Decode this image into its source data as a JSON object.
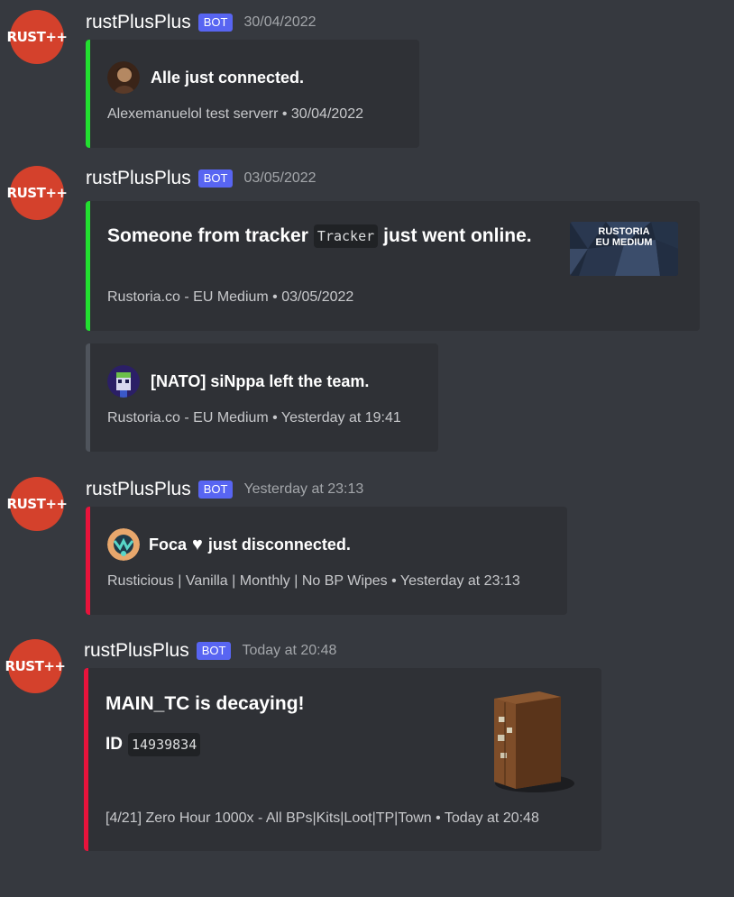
{
  "messages": [
    {
      "avatar_label": "RUST++",
      "username": "rustPlusPlus",
      "bot_tag": "BOT",
      "timestamp": "30/04/2022",
      "embed": {
        "author": "Alle just connected.",
        "footer": "Alexemanuelol test serverr • 30/04/2022",
        "color": "#22e030"
      }
    },
    {
      "avatar_label": "RUST++",
      "username": "rustPlusPlus",
      "bot_tag": "BOT",
      "timestamp": "03/05/2022",
      "embed": {
        "title_prefix": "Someone from tracker",
        "title_code": "Tracker",
        "title_suffix": "just went online.",
        "thumbnail_text_1": "RUSTORIA",
        "thumbnail_text_2": "EU MEDIUM",
        "footer": "Rustoria.co - EU Medium • 03/05/2022",
        "color": "#22e030"
      },
      "embed2": {
        "author": "[NATO] siNppa left the team.",
        "footer": "Rustoria.co - EU Medium • Yesterday at 19:41",
        "color": "#4f545c"
      }
    },
    {
      "avatar_label": "RUST++",
      "username": "rustPlusPlus",
      "bot_tag": "BOT",
      "timestamp": "Yesterday at 23:13",
      "embed": {
        "author_prefix": "Foca",
        "author_heart": "♥",
        "author_suffix": "just disconnected.",
        "footer": "Rusticious | Vanilla | Monthly | No BP Wipes • Yesterday at 23:13",
        "color": "#e8133b"
      }
    },
    {
      "avatar_label": "RUST++",
      "username": "rustPlusPlus",
      "bot_tag": "BOT",
      "timestamp": "Today at 20:48",
      "embed": {
        "title": "MAIN_TC is decaying!",
        "field_name": "ID",
        "field_value": "14939834",
        "footer": "[4/21] Zero Hour 1000x - All BPs|Kits|Loot|TP|Town • Today at 20:48",
        "color": "#e8133b"
      }
    }
  ]
}
